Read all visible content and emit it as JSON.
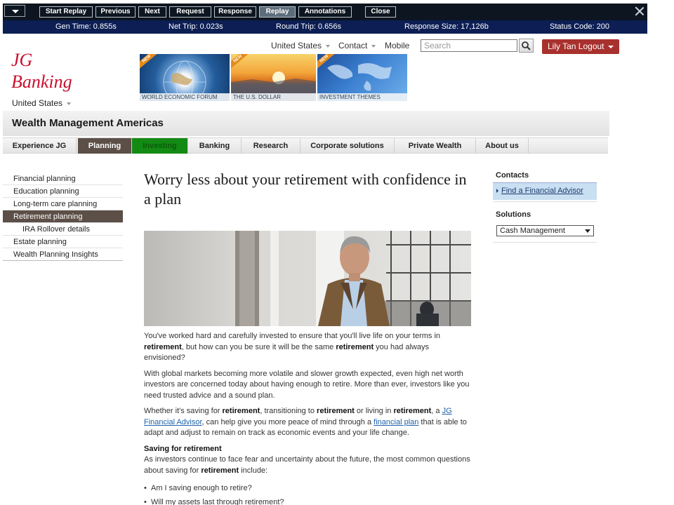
{
  "toolbar": {
    "buttons": [
      {
        "label": "Start Replay"
      },
      {
        "label": "Previous"
      },
      {
        "label": "Next"
      },
      {
        "label": "Request"
      },
      {
        "label": "Response"
      },
      {
        "label": "Replay",
        "active": true
      },
      {
        "label": "Annotations"
      },
      {
        "label": "Close"
      }
    ]
  },
  "status": {
    "gen_time": "Gen Time: 0.855s",
    "net_trip": "Net Trip: 0.023s",
    "round_trip": "Round Trip: 0.656s",
    "response_size": "Response Size: 17,126b",
    "status_code": "Status Code: 200"
  },
  "header": {
    "logo_line1": "JG",
    "logo_line2": "Banking",
    "country": "United States",
    "util_links": [
      "United States",
      "Contact",
      "Mobile"
    ],
    "search_placeholder": "Search",
    "logout": "Lily Tan Logout",
    "banners": [
      {
        "caption": "WORLD ECONOMIC FORUM",
        "badge": "NEW"
      },
      {
        "caption": "THE U.S. DOLLAR",
        "badge": "NEW"
      },
      {
        "caption": "INVESTMENT THEMES",
        "badge": "NEW"
      }
    ]
  },
  "section_title": "Wealth Management Americas",
  "nav": [
    {
      "label": "Experience JG"
    },
    {
      "label": "Planning",
      "selected": true
    },
    {
      "label": "Investing"
    },
    {
      "label": "Banking"
    },
    {
      "label": "Research"
    },
    {
      "label": "Corporate solutions"
    },
    {
      "label": "Private Wealth"
    },
    {
      "label": "About us"
    }
  ],
  "leftnav": [
    {
      "label": "Financial planning"
    },
    {
      "label": "Education planning"
    },
    {
      "label": "Long-term care planning"
    },
    {
      "label": "Retirement planning",
      "selected": true
    },
    {
      "label": "IRA Rollover details",
      "sub": true
    },
    {
      "label": "Estate planning"
    },
    {
      "label": "Wealth Planning Insights"
    }
  ],
  "main": {
    "headline": "Worry less about your retirement with confidence in a plan",
    "p1": {
      "a": "You've worked hard and carefully invested to ensure that you'll live life on your terms in ",
      "b": "retirement",
      "c": ", but how can you be sure it will be the same ",
      "d": "retirement",
      "e": " you had always envisioned?"
    },
    "p2": "With global markets becoming more volatile and slower growth expected, even high net worth investors are concerned today about having enough to retire. More than ever, investors like you need trusted advice and a sound plan.",
    "p3": {
      "a": "Whether it's saving for ",
      "b": "retirement",
      "c": ", transitioning to ",
      "d": "retirement",
      "e": " or living in ",
      "f": "retirement",
      "g": ", a ",
      "link1": "JG Financial Advisor",
      "h": ", can help give you more peace of mind through a ",
      "link2": "financial plan",
      "i": " that is able to adapt and adjust to remain on track as economic events and your life change."
    },
    "saving_heading": "Saving for retirement",
    "p4": {
      "a": "As investors continue to face fear and uncertainty about the future, the most common questions about saving for ",
      "b": "retirement",
      "c": " include:"
    },
    "bullets": [
      "Am I saving enough to retire?",
      "Will my assets last through retirement?"
    ]
  },
  "right": {
    "contacts_heading": "Contacts",
    "contacts_link": "Find a Financial Advisor",
    "solutions_heading": "Solutions",
    "solutions_selected": "Cash Management"
  },
  "colors": {
    "toolbar_bg": "#0d1620",
    "statusbar_bg": "#0c1e54",
    "brand_red": "#c8102e",
    "logout_bg": "#a8312e",
    "nav_selected": "#5c4f47",
    "nav_investing": "#138a13",
    "link": "#1e62a8"
  }
}
